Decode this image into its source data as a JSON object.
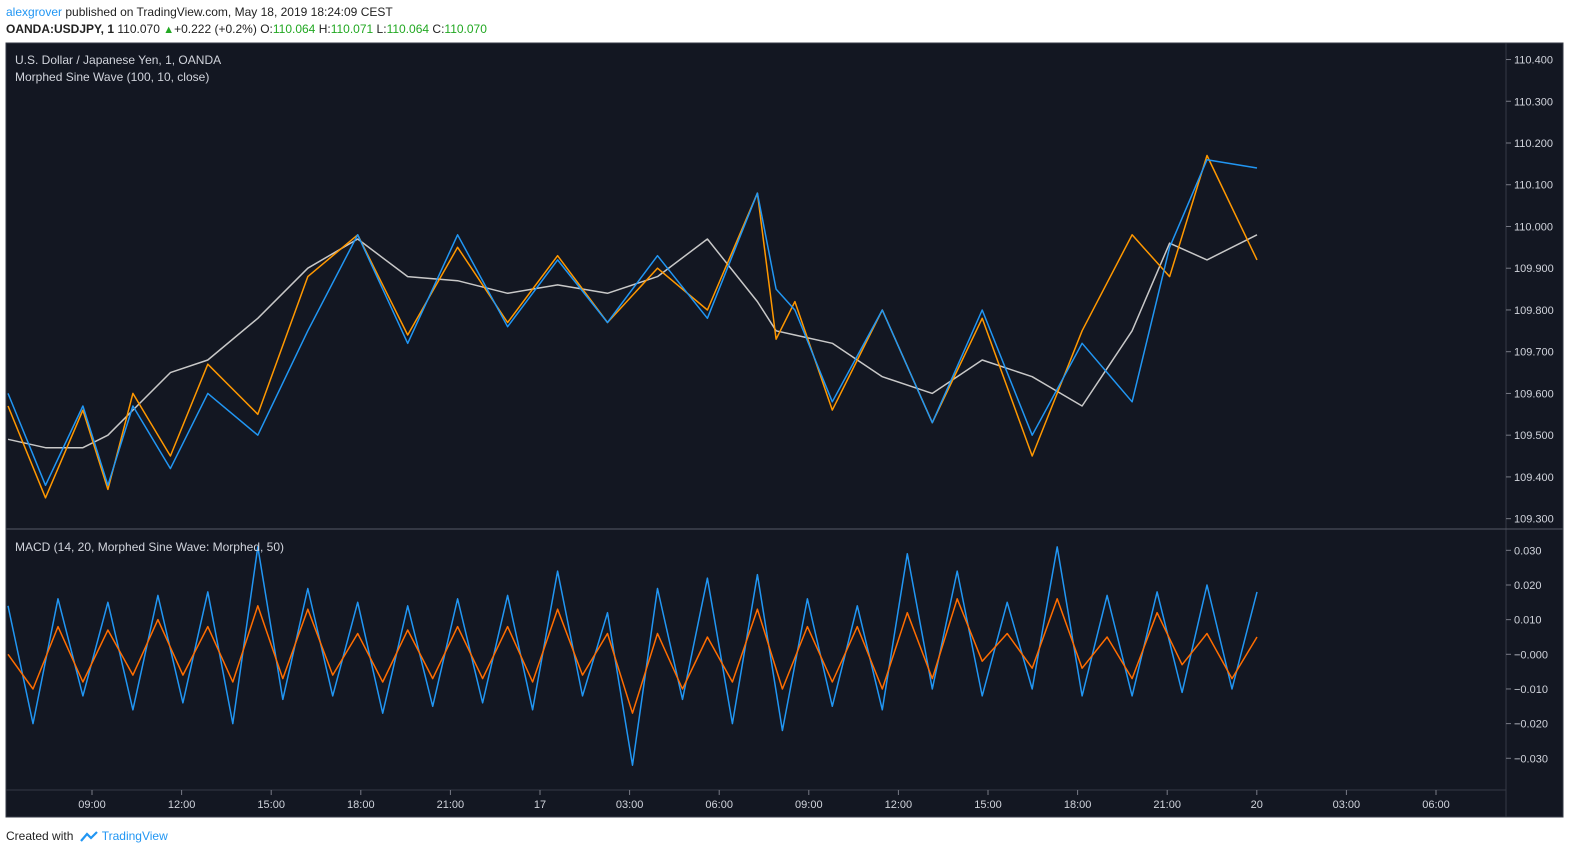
{
  "header": {
    "author": "alexgrover",
    "published": "published on TradingView.com, May 18, 2019 18:24:09 CEST",
    "symbol": "OANDA:USDJPY, 1",
    "last": "110.070",
    "change": "+0.222 (+0.2%)",
    "o_label": "O:",
    "o_value": "110.064",
    "h_label": "H:",
    "h_value": "110.071",
    "l_label": "L:",
    "l_value": "110.064",
    "c_label": "C:",
    "c_value": "110.070"
  },
  "main_pane": {
    "title": "U.S. Dollar / Japanese Yen, 1, OANDA",
    "indicator": "Morphed Sine Wave (100, 10, close)"
  },
  "macd_pane": {
    "title": "MACD (14, 20, Morphed Sine Wave: Morphed, 50)"
  },
  "footer": {
    "created_with": "Created with",
    "brand": "TradingView"
  },
  "colors": {
    "background": "#131722",
    "price": "#c8c8c8",
    "morphed": "#ff9800",
    "trend": "#2196f3",
    "macd": "#2196f3",
    "signal": "#ff6d00",
    "up": "#22a822"
  },
  "chart_data": [
    {
      "type": "line",
      "pane": "main",
      "x_ticks": [
        "09:00",
        "12:00",
        "15:00",
        "18:00",
        "21:00",
        "17",
        "03:00",
        "06:00",
        "09:00",
        "12:00",
        "15:00",
        "18:00",
        "21:00",
        "20",
        "03:00",
        "06:00"
      ],
      "y_ticks": [
        110.4,
        110.3,
        110.2,
        110.1,
        110.0,
        109.9,
        109.8,
        109.7,
        109.6,
        109.5,
        109.4,
        109.3
      ],
      "ylim": [
        109.28,
        110.43
      ],
      "series": [
        {
          "color": "price",
          "x": [
            0,
            0.03,
            0.06,
            0.08,
            0.1,
            0.13,
            0.16,
            0.2,
            0.24,
            0.28,
            0.32,
            0.36,
            0.4,
            0.44,
            0.48,
            0.52,
            0.56,
            0.6,
            0.615,
            0.63,
            0.66,
            0.7,
            0.74,
            0.78,
            0.82,
            0.86,
            0.9,
            0.93,
            0.96,
            1.0
          ],
          "y": [
            109.49,
            109.47,
            109.47,
            109.5,
            109.56,
            109.65,
            109.68,
            109.78,
            109.9,
            109.97,
            109.88,
            109.87,
            109.84,
            109.86,
            109.84,
            109.88,
            109.97,
            109.82,
            109.75,
            109.74,
            109.72,
            109.64,
            109.6,
            109.68,
            109.64,
            109.57,
            109.75,
            109.96,
            109.92,
            109.98
          ]
        },
        {
          "color": "morphed",
          "x": [
            0,
            0.03,
            0.06,
            0.08,
            0.1,
            0.13,
            0.16,
            0.2,
            0.24,
            0.28,
            0.32,
            0.36,
            0.4,
            0.44,
            0.48,
            0.52,
            0.56,
            0.6,
            0.615,
            0.63,
            0.66,
            0.7,
            0.74,
            0.78,
            0.82,
            0.86,
            0.9,
            0.93,
            0.96,
            1.0
          ],
          "y": [
            109.57,
            109.35,
            109.56,
            109.37,
            109.6,
            109.45,
            109.67,
            109.55,
            109.88,
            109.98,
            109.74,
            109.95,
            109.77,
            109.93,
            109.77,
            109.9,
            109.8,
            110.08,
            109.73,
            109.82,
            109.56,
            109.8,
            109.53,
            109.78,
            109.45,
            109.75,
            109.98,
            109.88,
            110.17,
            109.92
          ]
        },
        {
          "color": "trend",
          "x": [
            0,
            0.03,
            0.06,
            0.08,
            0.1,
            0.13,
            0.16,
            0.2,
            0.24,
            0.28,
            0.32,
            0.36,
            0.4,
            0.44,
            0.48,
            0.52,
            0.56,
            0.6,
            0.615,
            0.63,
            0.66,
            0.7,
            0.74,
            0.78,
            0.82,
            0.86,
            0.9,
            0.93,
            0.96,
            1.0
          ],
          "y": [
            109.6,
            109.38,
            109.57,
            109.38,
            109.57,
            109.42,
            109.6,
            109.5,
            109.75,
            109.98,
            109.72,
            109.98,
            109.76,
            109.92,
            109.77,
            109.93,
            109.78,
            110.08,
            109.85,
            109.8,
            109.58,
            109.8,
            109.53,
            109.8,
            109.5,
            109.72,
            109.58,
            109.95,
            110.16,
            110.14
          ]
        }
      ]
    },
    {
      "type": "line",
      "pane": "macd",
      "y_ticks": [
        0.03,
        0.02,
        0.01,
        -0.0,
        -0.01,
        -0.02,
        -0.03
      ],
      "y_tick_labels": [
        "0.030",
        "0.020",
        "0.010",
        "−0.000",
        "−0.010",
        "−0.020",
        "−0.030"
      ],
      "ylim": [
        -0.038,
        0.035
      ],
      "series": [
        {
          "color": "macd",
          "x": [
            0,
            0.02,
            0.04,
            0.06,
            0.08,
            0.1,
            0.12,
            0.14,
            0.16,
            0.18,
            0.2,
            0.22,
            0.24,
            0.26,
            0.28,
            0.3,
            0.32,
            0.34,
            0.36,
            0.38,
            0.4,
            0.42,
            0.44,
            0.46,
            0.48,
            0.5,
            0.52,
            0.54,
            0.56,
            0.58,
            0.6,
            0.62,
            0.64,
            0.66,
            0.68,
            0.7,
            0.72,
            0.74,
            0.76,
            0.78,
            0.8,
            0.82,
            0.84,
            0.86,
            0.88,
            0.9,
            0.92,
            0.94,
            0.96,
            0.98,
            1.0
          ],
          "y": [
            0.014,
            -0.02,
            0.016,
            -0.012,
            0.015,
            -0.016,
            0.017,
            -0.014,
            0.018,
            -0.02,
            0.031,
            -0.013,
            0.019,
            -0.012,
            0.015,
            -0.017,
            0.014,
            -0.015,
            0.016,
            -0.014,
            0.017,
            -0.016,
            0.024,
            -0.012,
            0.012,
            -0.032,
            0.019,
            -0.013,
            0.022,
            -0.02,
            0.023,
            -0.022,
            0.016,
            -0.015,
            0.014,
            -0.016,
            0.029,
            -0.01,
            0.024,
            -0.012,
            0.015,
            -0.01,
            0.031,
            -0.012,
            0.017,
            -0.012,
            0.018,
            -0.011,
            0.02,
            -0.01,
            0.018
          ]
        },
        {
          "color": "signal",
          "x": [
            0,
            0.02,
            0.04,
            0.06,
            0.08,
            0.1,
            0.12,
            0.14,
            0.16,
            0.18,
            0.2,
            0.22,
            0.24,
            0.26,
            0.28,
            0.3,
            0.32,
            0.34,
            0.36,
            0.38,
            0.4,
            0.42,
            0.44,
            0.46,
            0.48,
            0.5,
            0.52,
            0.54,
            0.56,
            0.58,
            0.6,
            0.62,
            0.64,
            0.66,
            0.68,
            0.7,
            0.72,
            0.74,
            0.76,
            0.78,
            0.8,
            0.82,
            0.84,
            0.86,
            0.88,
            0.9,
            0.92,
            0.94,
            0.96,
            0.98,
            1.0
          ],
          "y": [
            0.0,
            -0.01,
            0.008,
            -0.008,
            0.007,
            -0.006,
            0.01,
            -0.006,
            0.008,
            -0.008,
            0.014,
            -0.007,
            0.013,
            -0.006,
            0.006,
            -0.008,
            0.007,
            -0.007,
            0.008,
            -0.007,
            0.008,
            -0.008,
            0.013,
            -0.006,
            0.006,
            -0.017,
            0.006,
            -0.01,
            0.005,
            -0.008,
            0.013,
            -0.01,
            0.008,
            -0.008,
            0.008,
            -0.01,
            0.012,
            -0.007,
            0.016,
            -0.002,
            0.006,
            -0.004,
            0.016,
            -0.004,
            0.005,
            -0.007,
            0.012,
            -0.003,
            0.006,
            -0.007,
            0.005
          ]
        }
      ]
    }
  ]
}
